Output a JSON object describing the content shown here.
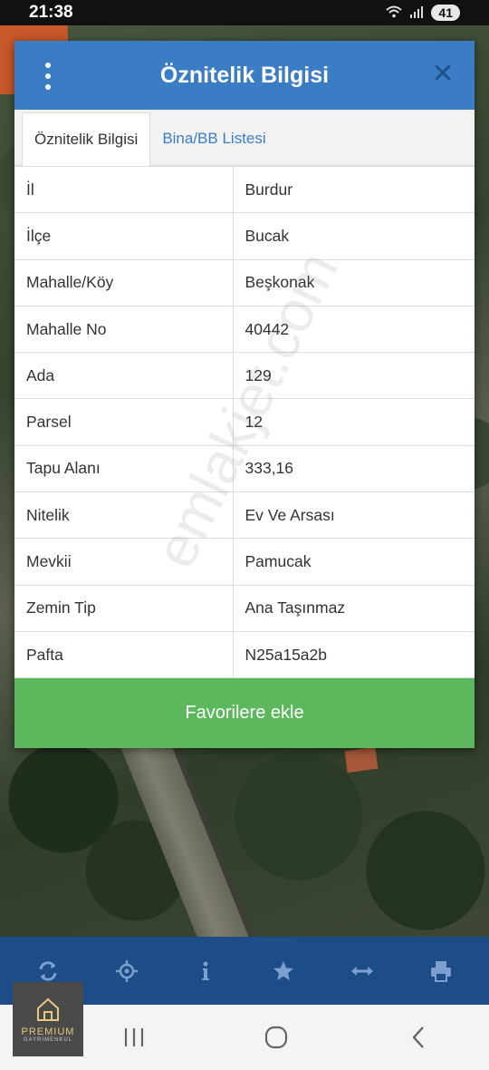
{
  "status_bar": {
    "time": "21:38",
    "battery": "41",
    "icons": [
      "wifi-icon",
      "signal-icon"
    ]
  },
  "dialog": {
    "title": "Öznitelik Bilgisi",
    "tabs": [
      {
        "label": "Öznitelik Bilgisi",
        "active": true
      },
      {
        "label": "Bina/BB Listesi",
        "active": false
      }
    ],
    "rows": [
      {
        "label": "İl",
        "value": "Burdur"
      },
      {
        "label": "İlçe",
        "value": "Bucak"
      },
      {
        "label": "Mahalle/Köy",
        "value": "Beşkonak"
      },
      {
        "label": "Mahalle No",
        "value": "40442"
      },
      {
        "label": "Ada",
        "value": "129"
      },
      {
        "label": "Parsel",
        "value": "12"
      },
      {
        "label": "Tapu Alanı",
        "value": "333,16"
      },
      {
        "label": "Nitelik",
        "value": "Ev Ve Arsası"
      },
      {
        "label": "Mevkii",
        "value": "Pamucak"
      },
      {
        "label": "Zemin Tip",
        "value": "Ana Taşınmaz"
      },
      {
        "label": "Pafta",
        "value": "N25a15a2b"
      }
    ],
    "favorite_button": "Favorilere ekle"
  },
  "watermark": "emlakjet.com",
  "toolbar": {
    "items": [
      "refresh-icon",
      "locate-icon",
      "info-icon",
      "star-icon",
      "measure-icon",
      "print-icon"
    ]
  },
  "logo": {
    "text": "PREMIUM",
    "subtext": "GAYRİMENKUL"
  },
  "colors": {
    "header": "#3b7dc4",
    "close": "#1d4f8a",
    "favorite": "#5cb85c",
    "toolbar": "#1d4d86"
  }
}
